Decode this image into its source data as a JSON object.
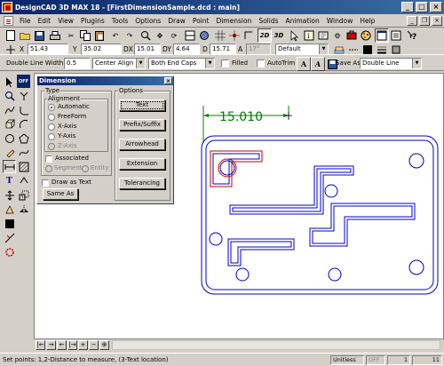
{
  "window": {
    "title": "DesignCAD 3D MAX 18 - [FirstDimensionSample.dcd : main]",
    "min": "_",
    "max": "□",
    "close": "×"
  },
  "menu": {
    "items": [
      "File",
      "Edit",
      "View",
      "Plugins",
      "Tools",
      "Options",
      "Draw",
      "Point",
      "Dimension",
      "Solids",
      "Animation",
      "Window",
      "Help"
    ],
    "doc_min": "_",
    "doc_restore": "❐",
    "doc_close": "×"
  },
  "coords": {
    "x_label": "X",
    "x_value": "51.43",
    "y_label": "Y",
    "y_value": "35.02",
    "dx_label": "DX",
    "dx_value": "15.01",
    "dy_label": "DY",
    "dy_value": "4.64",
    "d_label": "D",
    "d_value": "15.71",
    "angle_label": "A",
    "angle_value": "17°",
    "layer_value": "Default",
    "btn_2d": "2D",
    "btn_3d": "3D"
  },
  "lineopts": {
    "double_line_width_label": "Double Line Width:",
    "double_line_width_value": "0.5",
    "align_value": "Center Align",
    "caps_value": "Both End Caps",
    "filled_label": "Filled",
    "autotrim_label": "AutoTrim",
    "save_as_label": "Save As:",
    "save_as_value": "Double Line"
  },
  "dialog": {
    "title": "Dimension",
    "close": "×",
    "type_label": "Type",
    "alignment_label": "Alignment",
    "radio": [
      "Automatic",
      "FreeForm",
      "X-Axis",
      "Y-Axis",
      "Z-Axis"
    ],
    "selected_radio": "Automatic",
    "associated_label": "Associated",
    "segment_label": "Segment",
    "entity_label": "Entity",
    "draw_as_text_label": "Draw as Text",
    "same_as_label": "Same As",
    "options_label": "Options",
    "buttons": [
      "Text",
      "Prefix/Suffix",
      "Arrowhead",
      "Extension",
      "Tolerancing"
    ]
  },
  "drawing": {
    "dimension_text": "15.010",
    "dimension_color": "#008000",
    "outline_color": "#0000cc",
    "highlight_color": "#cc0000"
  },
  "bottom": {
    "arrows": [
      "|←",
      "→",
      "←",
      "|→",
      "+",
      "−",
      "⊕"
    ]
  },
  "status": {
    "message": "Set points: 1,2-Distance to measure, (3-Text location)",
    "units": "Unitless",
    "snap": "OFF",
    "count_a": "1",
    "count_b": "11"
  },
  "colors": {
    "titlebar": "#0a246a",
    "chrome": "#d4d0c8",
    "canvas": "#ffffff"
  }
}
